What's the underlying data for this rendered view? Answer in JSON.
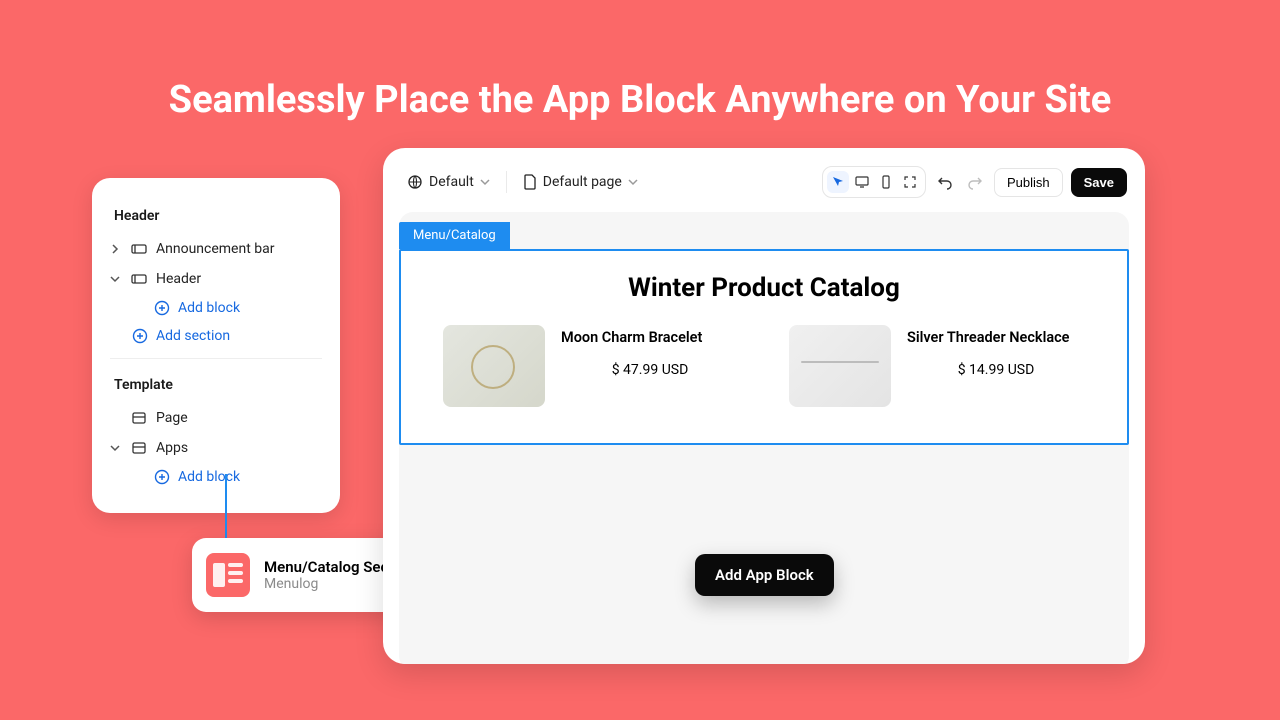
{
  "hero": {
    "title": "Seamlessly Place the App Block Anywhere on Your Site"
  },
  "sidebar": {
    "heading_header": "Header",
    "items": [
      {
        "label": "Announcement bar"
      },
      {
        "label": "Header"
      }
    ],
    "add_block": "Add block",
    "add_section": "Add section",
    "heading_template": "Template",
    "template_items": [
      {
        "label": "Page"
      },
      {
        "label": "Apps"
      }
    ]
  },
  "appblock": {
    "title": "Menu/Catalog Section",
    "subtitle": "Menulog"
  },
  "editor": {
    "topbar": {
      "theme": "Default",
      "page": "Default page",
      "publish": "Publish",
      "save": "Save"
    },
    "selection": {
      "tab": "Menu/Catalog"
    },
    "catalog": {
      "title": "Winter Product Catalog",
      "products": [
        {
          "name": "Moon Charm Bracelet",
          "price": "$ 47.99 USD"
        },
        {
          "name": "Silver Threader Necklace",
          "price": "$ 14.99 USD"
        }
      ]
    },
    "add_app_block": "Add App Block"
  }
}
